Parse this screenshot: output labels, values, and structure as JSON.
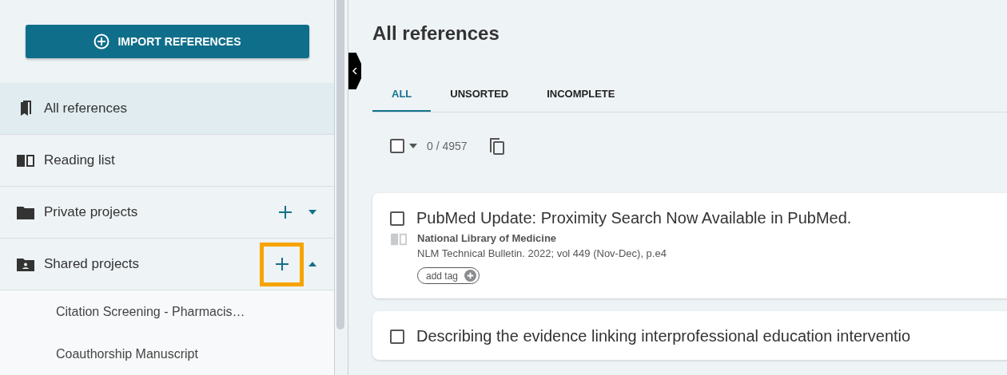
{
  "sidebar": {
    "import_button": {
      "label": "IMPORT REFERENCES"
    },
    "items": [
      {
        "kind": "all",
        "label": "All references",
        "selected": true
      },
      {
        "kind": "reading",
        "label": "Reading list",
        "selected": false
      },
      {
        "kind": "private",
        "label": "Private projects",
        "selected": false,
        "expanded": false,
        "add_highlighted": false
      },
      {
        "kind": "shared",
        "label": "Shared projects",
        "selected": false,
        "expanded": true,
        "add_highlighted": true,
        "children": [
          {
            "label": "Citation Screening - Pharmacis…"
          },
          {
            "label": "Coauthorship Manuscript"
          }
        ]
      }
    ]
  },
  "main": {
    "title": "All references",
    "tabs": [
      {
        "label": "ALL",
        "selected": true
      },
      {
        "label": "UNSORTED",
        "selected": false
      },
      {
        "label": "INCOMPLETE",
        "selected": false
      }
    ],
    "toolbar": {
      "select_all_checked": false,
      "count": "0 / 4957"
    },
    "references": [
      {
        "checked": false,
        "title": "PubMed Update: Proximity Search Now Available in PubMed.",
        "author": "National Library of Medicine",
        "source": "NLM Technical Bulletin. 2022; vol 449 (Nov-Dec), p.e4",
        "tag_button": "add tag"
      },
      {
        "checked": false,
        "title": "Describing the evidence linking interprofessional education interventio"
      }
    ]
  }
}
